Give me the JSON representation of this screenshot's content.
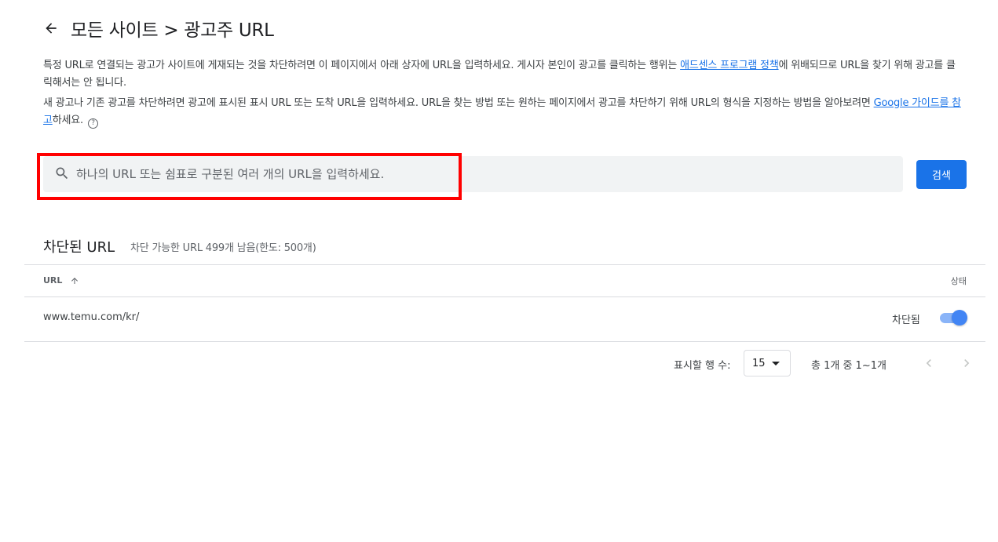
{
  "header": {
    "title": "모든 사이트 > 광고주 URL",
    "back_icon": "arrow-back-icon"
  },
  "description": {
    "p1_before": "특정 URL로 연결되는 광고가 사이트에 게재되는 것을 차단하려면 이 페이지에서 아래 상자에 URL을 입력하세요. 게시자 본인이 광고를 클릭하는 행위는 ",
    "p1_link": "애드센스 프로그램 정책",
    "p1_after": "에 위배되므로 URL을 찾기 위해 광고를 클릭해서는 안 됩니다.",
    "p2_before": "새 광고나 기존 광고를 차단하려면 광고에 표시된 표시 URL 또는 도착 URL을 입력하세요. URL을 찾는 방법 또는 원하는 페이지에서 광고를 차단하기 위해 URL의 형식을 지정하는 방법을 알아보려면 ",
    "p2_link": "Google 가이드를 참고",
    "p2_after": "하세요.",
    "help_icon": "help-circle-icon",
    "help_glyph": "?"
  },
  "search": {
    "placeholder": "하나의 URL 또는 쉼표로 구분된 여러 개의 URL을 입력하세요.",
    "value": "",
    "button_label": "검색",
    "icon": "search-icon",
    "highlight_color": "#ff0000"
  },
  "blocked": {
    "title": "차단된 URL",
    "subtitle": "차단 가능한 URL 499개 남음(한도: 500개)",
    "columns": {
      "url": "URL",
      "status": "상태"
    },
    "sort_icon": "arrow-up-icon",
    "rows": [
      {
        "url": "www.temu.com/kr/",
        "status": "차단됨",
        "toggle_on": true
      }
    ]
  },
  "pagination": {
    "rows_label": "표시할 행 수:",
    "rows_value": "15",
    "range": "총 1개 중 1~1개",
    "prev_icon": "chevron-left-icon",
    "next_icon": "chevron-right-icon"
  },
  "colors": {
    "accent": "#1a73e8",
    "toggle_track": "#8ab4f8",
    "toggle_thumb": "#4285f4",
    "search_bg": "#f1f3f4"
  }
}
